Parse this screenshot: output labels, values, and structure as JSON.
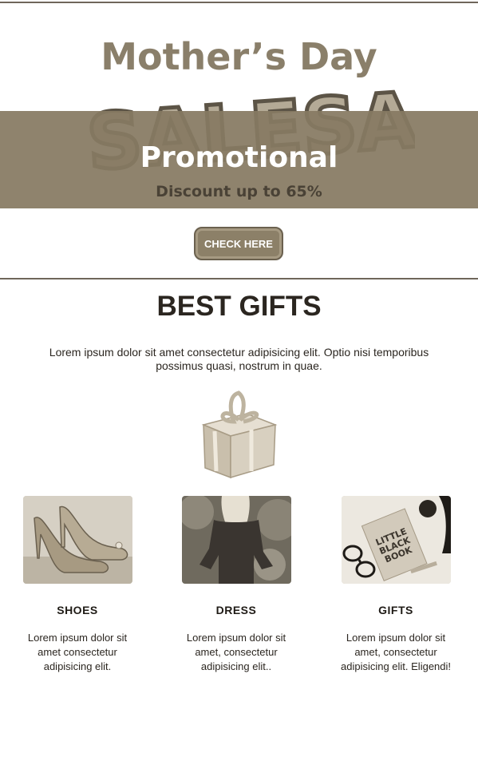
{
  "hero": {
    "title": "Mother’s Day",
    "sale_word": "SALESALE",
    "promo_label": "Promotional",
    "discount": "Discount up to 65%",
    "cta_label": "CHECK HERE"
  },
  "section": {
    "title": "BEST GIFTS",
    "intro": "Lorem ipsum dolor sit amet consectetur adipisicing elit. Optio nisi temporibus possimus quasi, nostrum in quae."
  },
  "products": [
    {
      "name": "SHOES",
      "desc": "Lorem ipsum dolor sit amet consectetur adipisicing elit.",
      "image": "high-heel-shoes-photo"
    },
    {
      "name": "DRESS",
      "desc": "Lorem ipsum dolor sit amet, consectetur adipisicing elit..",
      "image": "woman-in-dress-photo"
    },
    {
      "name": "GIFTS",
      "desc": "Lorem ipsum dolor sit amet, consectetur adipisicing elit. Eligendi!",
      "image": "book-and-glasses-photo",
      "book_text": [
        "LITTLE",
        "BLACK",
        "BOOK"
      ]
    }
  ],
  "colors": {
    "tone": "#867a62",
    "ink": "#2b2620",
    "button": "#8c8068"
  }
}
